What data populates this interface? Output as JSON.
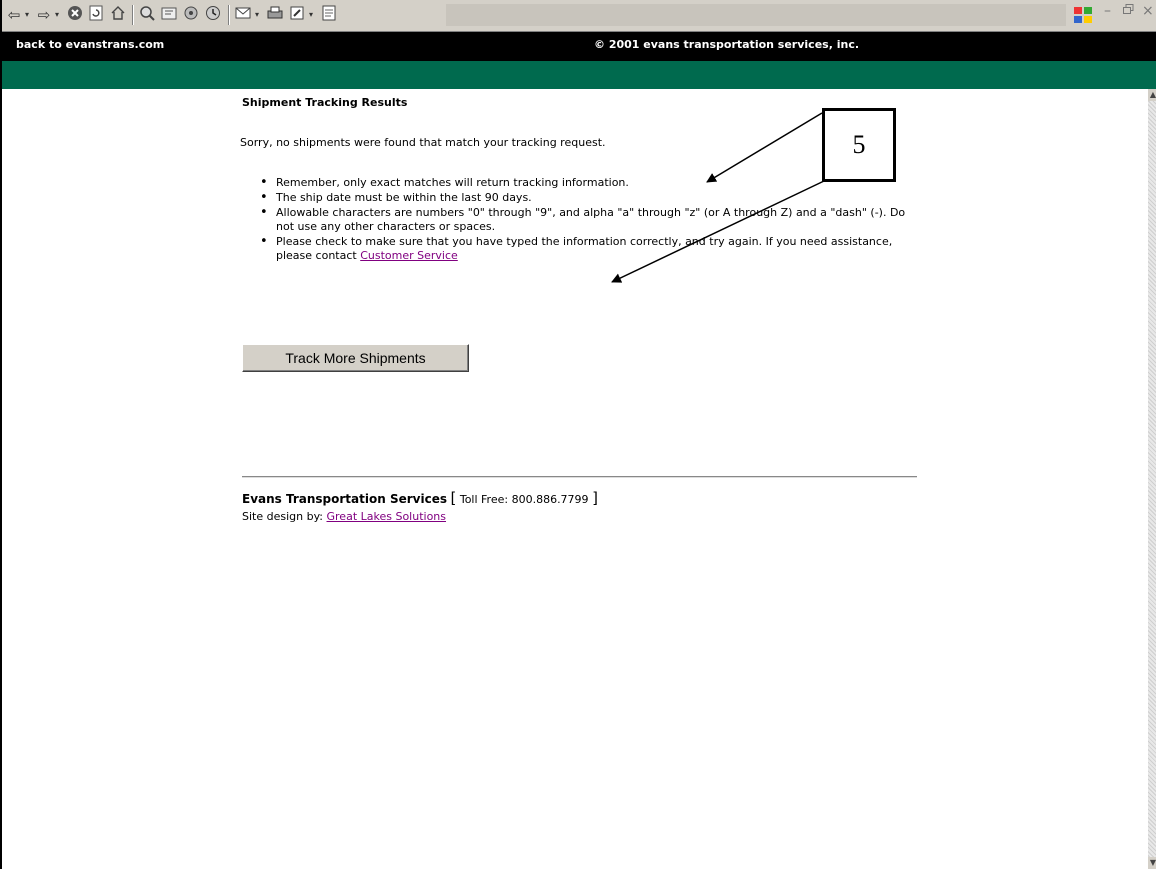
{
  "header": {
    "back_link": "back to evanstrans.com",
    "copyright": "© 2001 evans transportation services, inc."
  },
  "toolbar": {
    "icons": [
      "back-icon",
      "forward-icon",
      "stop-icon",
      "refresh-icon",
      "home-icon",
      "search-icon",
      "favorites-icon",
      "history-icon",
      "media-icon",
      "mail-icon",
      "print-icon",
      "edit-icon",
      "discuss-icon"
    ],
    "window_controls": [
      "minimize",
      "restore",
      "close"
    ]
  },
  "main": {
    "title": "Shipment Tracking Results",
    "message": "Sorry, no shipments were found that match your tracking request.",
    "tips": [
      "Remember, only exact matches will return tracking information.",
      "The ship date must be within the last 90 days.",
      "Allowable characters are numbers \"0\" through \"9\", and alpha \"a\" through \"z\" (or A through Z) and a \"dash\" (-). Do not use any other characters or spaces."
    ],
    "tip4_prefix": "Please check to make sure that you have typed the information correctly, and try again. If you need assistance, please contact ",
    "tip4_link": "Customer Service",
    "track_button": "Track More Shipments"
  },
  "footer": {
    "company": "Evans Transportation Services",
    "bracket_open": "[",
    "toll_free": " Toll Free: 800.886.7799 ",
    "bracket_close": "]",
    "design_prefix": "Site design by: ",
    "design_link": "Great Lakes Solutions"
  },
  "annotation": {
    "label": "5"
  },
  "colors": {
    "green_bar": "#006a4e",
    "link": "#800080"
  }
}
